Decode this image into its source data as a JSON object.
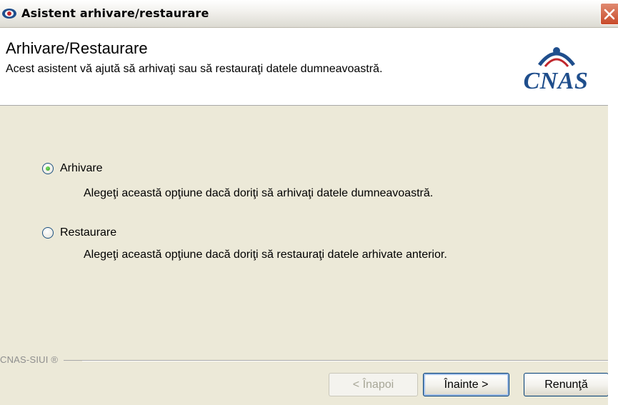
{
  "window": {
    "title": "Asistent arhivare/restaurare",
    "close_symbol": "✕"
  },
  "header": {
    "title": "Arhivare/Restaurare",
    "subtitle": "Acest asistent vă ajută să arhivaţi sau să restauraţi datele dumneavoastră.",
    "logo_text": "CNAS",
    "logo_color": "#1f4e8c",
    "logo_accent_color": "#c0272d"
  },
  "options": [
    {
      "label": "Arhivare",
      "description": "Alegeţi această opţiune dacă doriţi să arhivaţi datele dumneavoastră.",
      "selected": true
    },
    {
      "label": "Restaurare",
      "description": "Alegeţi această opţiune dacă doriţi să restauraţi datele arhivate anterior.",
      "selected": false
    }
  ],
  "footer": {
    "brand": "CNAS-SIUI ®",
    "back_label": "< Înapoi",
    "next_label": "Înainte >",
    "cancel_label": "Renunţă"
  }
}
